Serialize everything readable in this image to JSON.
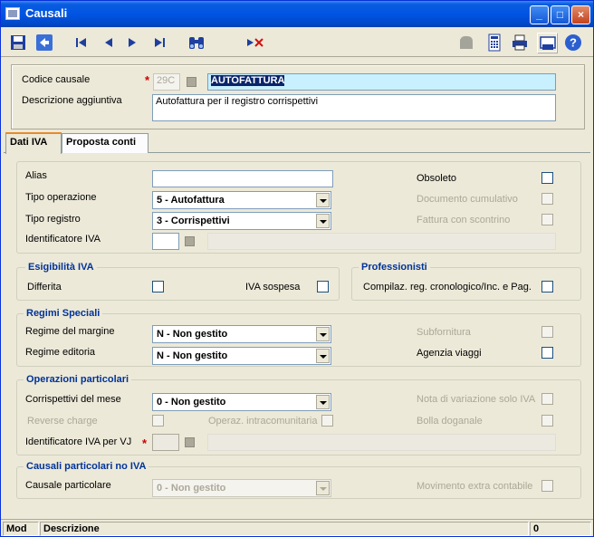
{
  "window": {
    "title": "Causali",
    "minimize": "_",
    "maximize": "□",
    "close": "×"
  },
  "toolbar": {
    "icons": [
      "save-icon",
      "back-icon",
      "first-record-icon",
      "previous-record-icon",
      "next-record-icon",
      "last-record-icon",
      "binoculars-icon",
      "delete-filter-icon",
      "gray-shape-icon",
      "calculator-icon",
      "printer-icon",
      "print-preview-icon",
      "help-icon"
    ]
  },
  "header": {
    "codice_label": "Codice causale",
    "codice_value": "29C",
    "descrizione_value": "AUTOFATTURA",
    "descr_agg_label": "Descrizione aggiuntiva",
    "descr_agg_value": "Autofattura per il registro corrispettivi"
  },
  "tabs": [
    {
      "label": "Dati IVA"
    },
    {
      "label": "Proposta conti"
    }
  ],
  "general": {
    "alias_label": "Alias",
    "alias_value": "",
    "tipo_operazione_label": "Tipo operazione",
    "tipo_operazione_value": "5  - Autofattura",
    "tipo_registro_label": "Tipo registro",
    "tipo_registro_value": "3  - Corrispettivi",
    "identificatore_iva_label": "Identificatore IVA",
    "identificatore_iva_value": "",
    "obsoleto_label": "Obsoleto",
    "documento_cumulativo_label": "Documento cumulativo",
    "fattura_scontrino_label": "Fattura con scontrino"
  },
  "esigibilita": {
    "title": "Esigibilità IVA",
    "differita_label": "Differita",
    "iva_sospesa_label": "IVA sospesa"
  },
  "professionisti": {
    "title": "Professionisti",
    "compilaz_label": "Compilaz. reg. cronologico/Inc. e Pag."
  },
  "regimi": {
    "title": "Regimi Speciali",
    "margine_label": "Regime del margine",
    "margine_value": "N  - Non gestito",
    "editoria_label": "Regime editoria",
    "editoria_value": "N  - Non gestito",
    "subfornitura_label": "Subfornitura",
    "agenzia_viaggi_label": "Agenzia viaggi"
  },
  "operazioni": {
    "title": "Operazioni particolari",
    "corrispettivi_label": "Corrispettivi del mese",
    "corrispettivi_value": "0  - Non gestito",
    "reverse_label": "Reverse charge",
    "intracomunitaria_label": "Operaz. intracomunitaria",
    "nota_variazione_label": "Nota di variazione solo IVA",
    "bolla_doganale_label": "Bolla doganale",
    "identificatore_vj_label": "Identificatore IVA per VJ",
    "identificatore_vj_value": ""
  },
  "causali_no_iva": {
    "title": "Causali particolari no IVA",
    "causale_label": "Causale particolare",
    "causale_value": "0  - Non gestito",
    "movimento_label": "Movimento extra contabile"
  },
  "statusbar": {
    "mod": "Mod",
    "descrizione": "Descrizione",
    "count": "0"
  },
  "colors": {
    "title_blue": "#0054e3",
    "group_title": "#003399",
    "highlight": "#c8f0ff",
    "required": "#cc0000"
  }
}
